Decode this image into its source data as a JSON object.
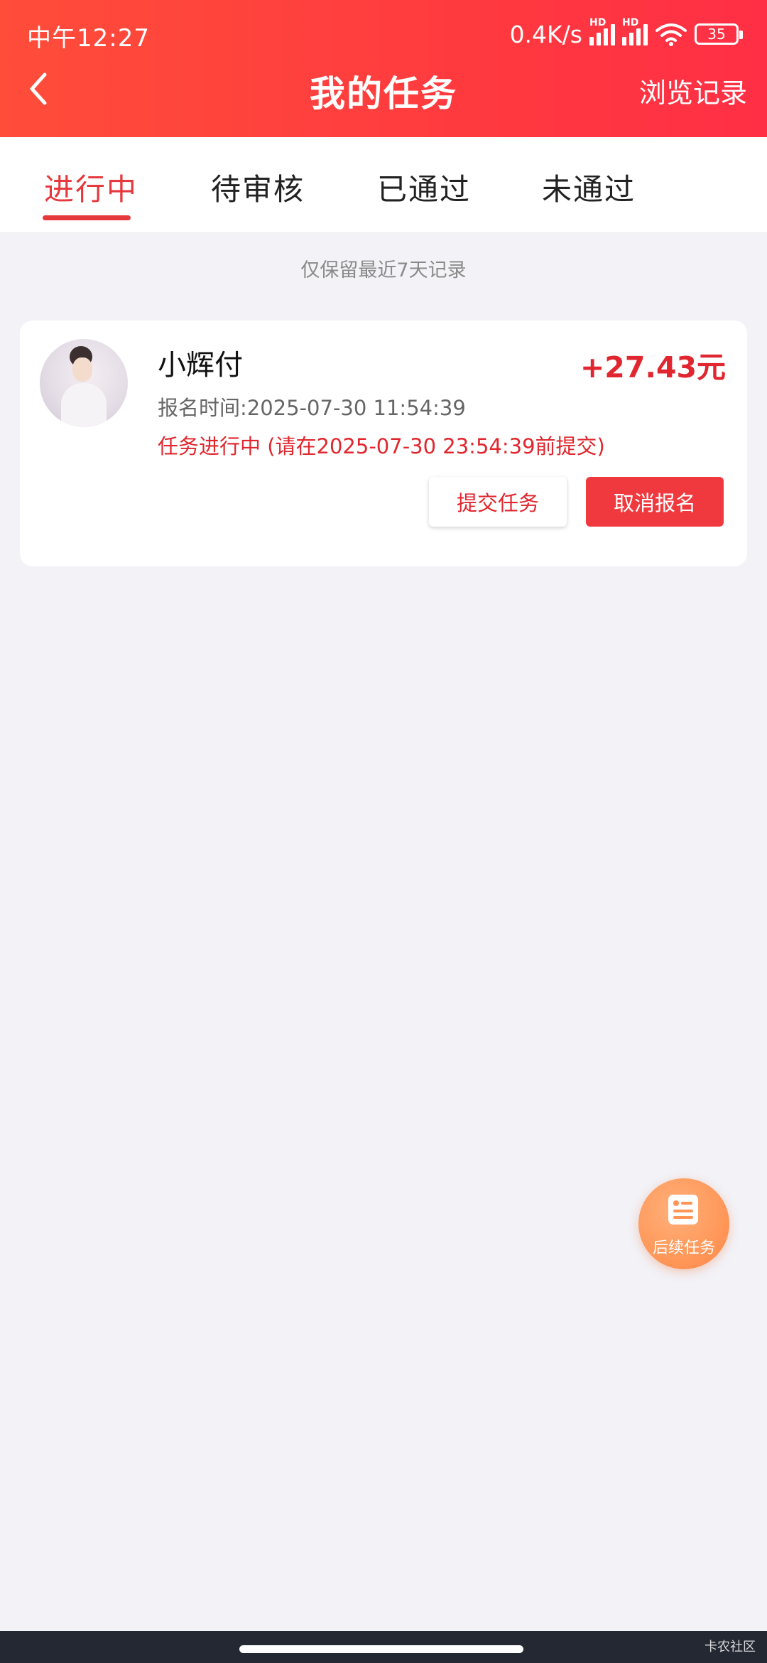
{
  "status_bar": {
    "time": "中午12:27",
    "network_speed": "0.4K/s",
    "signal_badge": "HD",
    "battery": "35"
  },
  "nav": {
    "title": "我的任务",
    "history_label": "浏览记录"
  },
  "tabs": [
    {
      "label": "进行中",
      "active": true
    },
    {
      "label": "待审核",
      "active": false
    },
    {
      "label": "已通过",
      "active": false
    },
    {
      "label": "未通过",
      "active": false
    }
  ],
  "notice": "仅保留最近7天记录",
  "task": {
    "name": "小辉付",
    "reward": "+27.43元",
    "signup_time": "报名时间:2025-07-30 11:54:39",
    "status": "任务进行中 (请在2025-07-30 23:54:39前提交)",
    "submit_label": "提交任务",
    "cancel_label": "取消报名"
  },
  "fab": {
    "label": "后续任务",
    "icon": "task-list-icon"
  },
  "watermark": "卡农社区",
  "colors": {
    "accent": "#e5393d",
    "header_gradient_start": "#ff4d3a",
    "header_gradient_end": "#ff2f45",
    "fab": "#ff9455"
  }
}
